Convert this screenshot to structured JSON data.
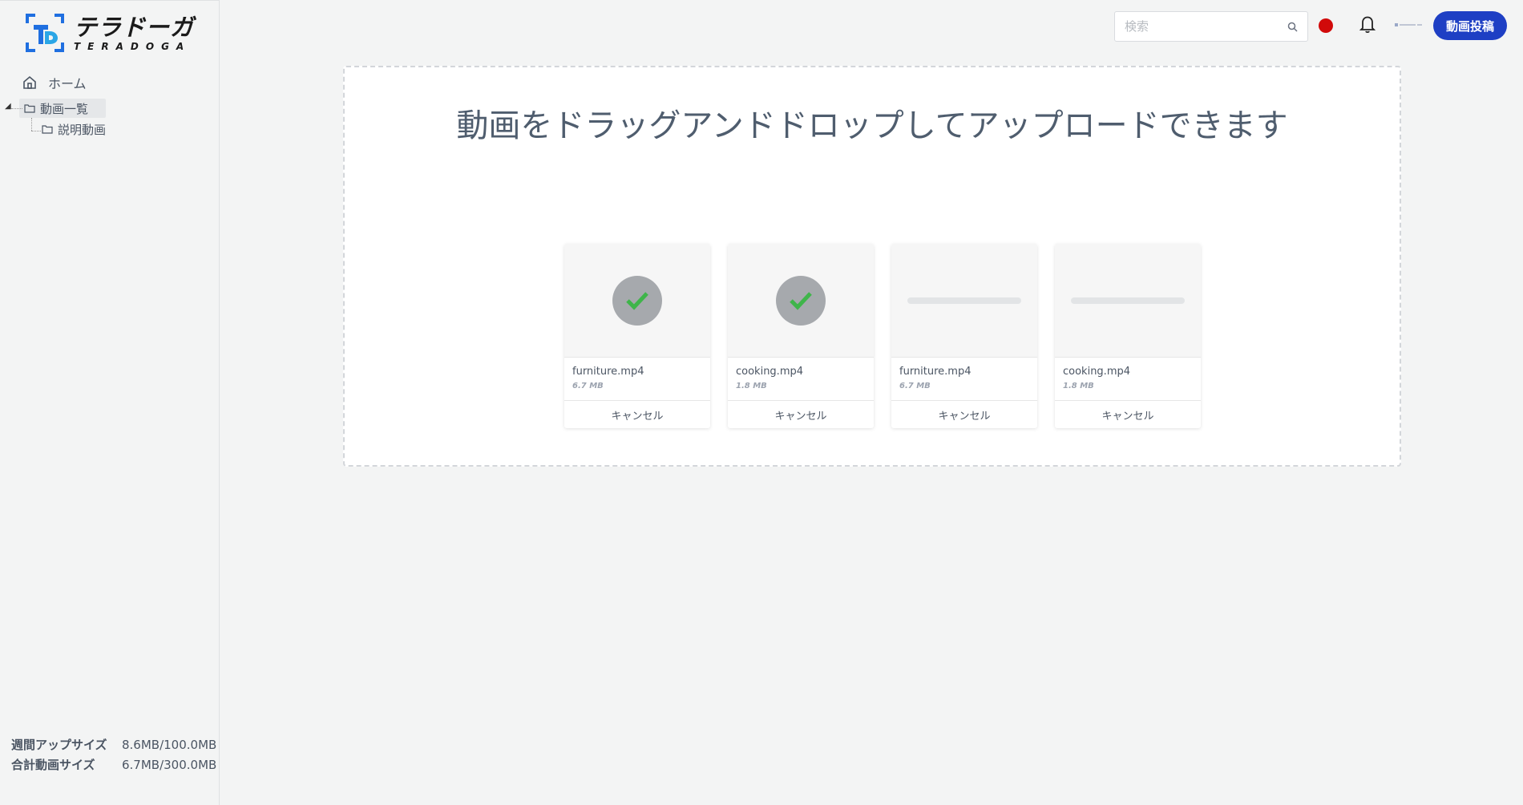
{
  "logo": {
    "jp": "テラドーガ",
    "en": "TERADOGA",
    "mark": "td-logo-mark"
  },
  "sidebar": {
    "home_label": "ホーム",
    "tree": {
      "root": "動画一覧",
      "child": "説明動画"
    },
    "usage": [
      {
        "label": "週間アップサイズ",
        "value": "8.6MB/100.0MB"
      },
      {
        "label": "合計動画サイズ",
        "value": "6.7MB/300.0MB"
      }
    ]
  },
  "header": {
    "search_placeholder": "検索",
    "post_label": "動画投稿",
    "flag_color": "#d10a0a"
  },
  "dropzone": {
    "title": "動画をドラッグアンドドロップしてアップロードできます",
    "files": [
      {
        "name": "furniture.mp4",
        "size": "6.7 MB",
        "status": "complete",
        "cancel": "キャンセル"
      },
      {
        "name": "cooking.mp4",
        "size": "1.8 MB",
        "status": "complete",
        "cancel": "キャンセル"
      },
      {
        "name": "furniture.mp4",
        "size": "6.7 MB",
        "status": "uploading",
        "cancel": "キャンセル"
      },
      {
        "name": "cooking.mp4",
        "size": "1.8 MB",
        "status": "uploading",
        "cancel": "キャンセル"
      }
    ]
  },
  "colors": {
    "accent": "#1e3fc4",
    "check": "#3fb54a"
  }
}
